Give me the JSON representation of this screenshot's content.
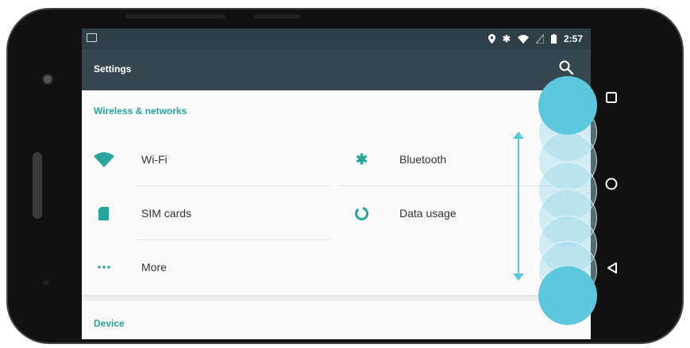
{
  "status_bar": {
    "time": "2:57",
    "icons": [
      "location-icon",
      "bluetooth-icon",
      "wifi-icon",
      "no-sim-icon",
      "battery-icon"
    ]
  },
  "toolbar": {
    "title": "Settings",
    "search_icon": "search-icon"
  },
  "sections": [
    {
      "header": "Wireless & networks",
      "items": [
        {
          "label": "Wi-Fi",
          "icon": "wifi-icon"
        },
        {
          "label": "Bluetooth",
          "icon": "bluetooth-icon"
        },
        {
          "label": "SIM cards",
          "icon": "sim-card-icon"
        },
        {
          "label": "Data usage",
          "icon": "data-usage-icon"
        },
        {
          "label": "More",
          "icon": "more-icon"
        }
      ]
    },
    {
      "header": "Device"
    }
  ],
  "nav_bar": [
    "recents-square-icon",
    "home-circle-icon",
    "back-triangle-icon"
  ],
  "colors": {
    "accent": "#26a69a",
    "toolbar": "#37474f",
    "status_bar": "#2e3f47",
    "gesture": "#5cc7dd"
  }
}
